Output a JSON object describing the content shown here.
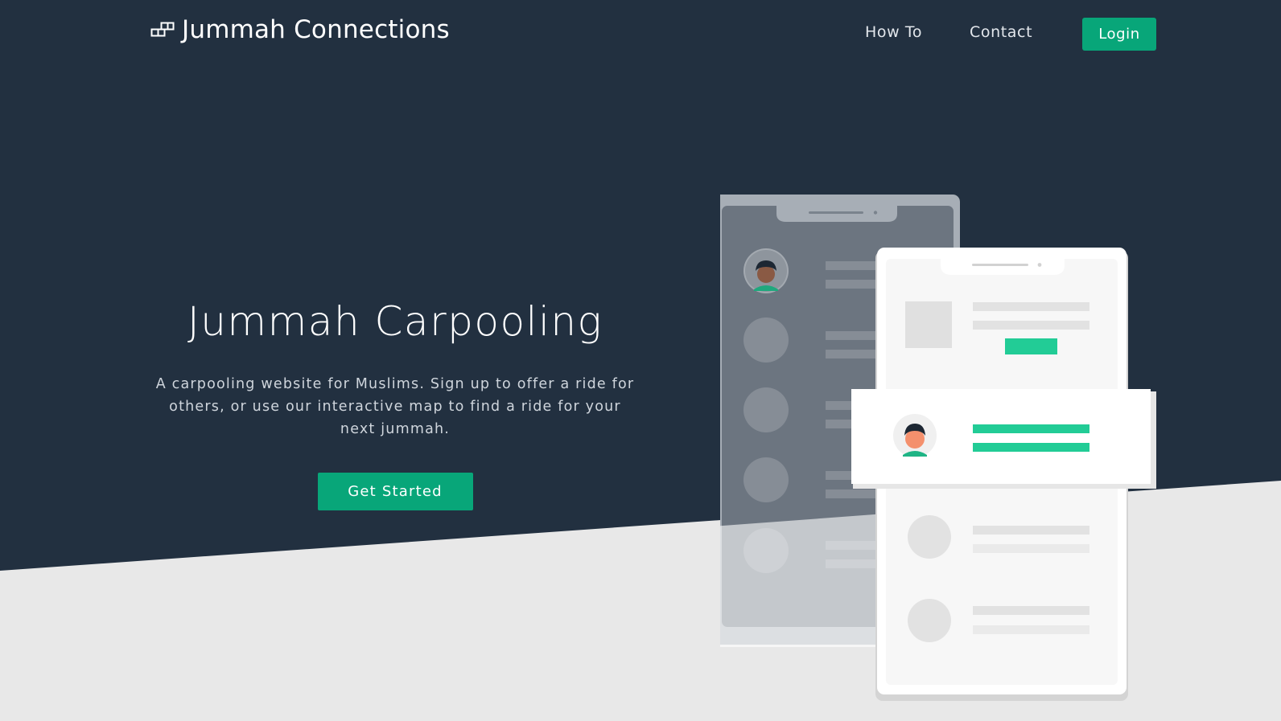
{
  "brand": {
    "name": "Jummah Connections",
    "icon": "squares-logo-icon"
  },
  "nav": {
    "links": [
      "How To",
      "Contact"
    ],
    "login_label": "Login"
  },
  "hero": {
    "title": "Jummah Carpooling",
    "subtitle": "A carpooling website for Muslims. Sign up to offer a ride for others, or use our interactive map to find a ride for your next jummah.",
    "cta_label": "Get Started"
  },
  "illustration": {
    "icon": "phone-ride-list-illustration"
  },
  "colors": {
    "navy": "#223040",
    "accent": "#08a679",
    "accent_light": "#22cc96",
    "light_bg": "#e8e8e8"
  }
}
